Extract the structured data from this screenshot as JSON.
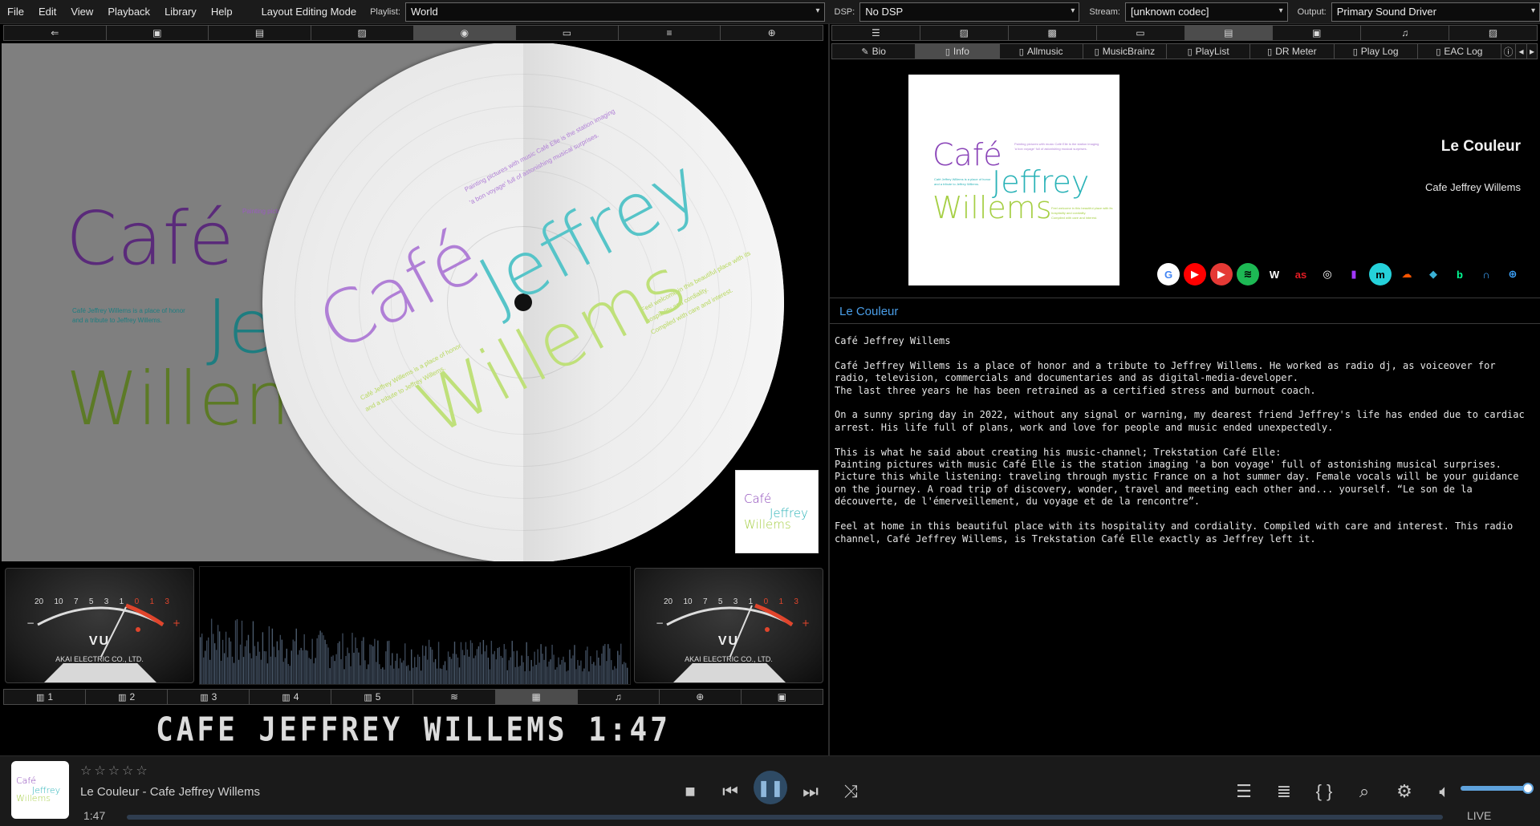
{
  "menubar": {
    "items": [
      "File",
      "Edit",
      "View",
      "Playback",
      "Library",
      "Help"
    ],
    "layout_mode": "Layout Editing Mode",
    "playlist_label": "Playlist:",
    "playlist_value": "World",
    "dsp_label": "DSP:",
    "dsp_value": "No DSP",
    "stream_label": "Stream:",
    "stream_value": "[unknown codec]",
    "output_label": "Output:",
    "output_value": "Primary Sound Driver"
  },
  "left_toolbar_icons": [
    "back-icon",
    "box-icon",
    "archive-icon",
    "image-icon",
    "disc-icon",
    "caption-icon",
    "stack-icon",
    "target-icon"
  ],
  "right_toolbar_icons": [
    "list-icon",
    "image-icon",
    "photo-icon",
    "caption-icon",
    "document-icon",
    "archive-icon",
    "music-icon",
    "image2-icon"
  ],
  "right_tabs": [
    {
      "label": "Bio",
      "icon": "pencil-icon",
      "active": false
    },
    {
      "label": "Info",
      "icon": "clipboard-icon",
      "active": true
    },
    {
      "label": "Allmusic",
      "icon": "clipboard-icon",
      "active": false
    },
    {
      "label": "MusicBrainz",
      "icon": "clipboard-icon",
      "active": false
    },
    {
      "label": "PlayList",
      "icon": "clipboard-icon",
      "active": false
    },
    {
      "label": "DR Meter",
      "icon": "clipboard-icon",
      "active": false
    },
    {
      "label": "Play Log",
      "icon": "clipboard-icon",
      "active": false
    },
    {
      "label": "EAC Log",
      "icon": "clipboard-icon",
      "active": false
    }
  ],
  "artwork": {
    "word1": "Café",
    "word2": "Jeffrey",
    "word3": "Willems",
    "tagline1": "Painting pictures with music Café Elle is the station imaging",
    "tagline2": "'a bon voyage' full of astonishing musical surprises.",
    "caption1": "Café Jeffrey Willems is a place of honor",
    "caption2": "and a tribute to Jeffrey Willems.",
    "caption3": "Feel welcome in this beautiful place with its",
    "caption4": "hospitality and cordiality.",
    "caption5": "Compiled with care and interest."
  },
  "vu": {
    "scale": [
      "20",
      "10",
      "7",
      "5",
      "3",
      "1",
      "0",
      "1",
      "3"
    ],
    "label": "VU",
    "brand": "AKAI ELECTRIC CO., LTD."
  },
  "visual_tabs": [
    {
      "label": "1",
      "icon": "bar-chart-icon",
      "active": false
    },
    {
      "label": "2",
      "icon": "bar-chart-icon",
      "active": false
    },
    {
      "label": "3",
      "icon": "bar-chart-icon",
      "active": false
    },
    {
      "label": "4",
      "icon": "bar-chart-icon",
      "active": false
    },
    {
      "label": "5",
      "icon": "bar-chart-icon",
      "active": false
    },
    {
      "label": "",
      "icon": "waves-icon",
      "active": false
    },
    {
      "label": "",
      "icon": "display-icon",
      "active": true
    },
    {
      "label": "",
      "icon": "music-icon",
      "active": false
    },
    {
      "label": "",
      "icon": "globe-icon",
      "active": false
    },
    {
      "label": "",
      "icon": "calendar-icon",
      "active": false
    }
  ],
  "display_text": "CAFE JEFFREY WILLEMS 1:47",
  "track": {
    "title": "Le Couleur",
    "artist": "Cafe Jeffrey Willems"
  },
  "link_icons": [
    {
      "name": "google-icon",
      "glyph": "G",
      "color": "#ffffff",
      "fg": "#4285f4"
    },
    {
      "name": "youtube-icon",
      "glyph": "▶",
      "color": "#ff0000",
      "fg": "#ffffff"
    },
    {
      "name": "youtube-music-icon",
      "glyph": "▶",
      "color": "#e53935",
      "fg": "#ffffff"
    },
    {
      "name": "spotify-icon",
      "glyph": "≋",
      "color": "#1db954",
      "fg": "#000000"
    },
    {
      "name": "wikipedia-icon",
      "glyph": "W",
      "color": "#000000",
      "fg": "#ffffff"
    },
    {
      "name": "lastfm-icon",
      "glyph": "as",
      "color": "#000000",
      "fg": "#e31b23"
    },
    {
      "name": "discogs-icon",
      "glyph": "◎",
      "color": "#000000",
      "fg": "#ffffff"
    },
    {
      "name": "deezer-icon",
      "glyph": "▮",
      "color": "#000000",
      "fg": "#a238ff"
    },
    {
      "name": "amazon-music-icon",
      "glyph": "m",
      "color": "#25d1da",
      "fg": "#000000"
    },
    {
      "name": "soundcloud-icon",
      "glyph": "☁",
      "color": "#000000",
      "fg": "#ff5500"
    },
    {
      "name": "tidal-icon",
      "glyph": "◆",
      "color": "#000000",
      "fg": "#39b0d4"
    },
    {
      "name": "beatport-icon",
      "glyph": "b",
      "color": "#000000",
      "fg": "#01ff95"
    },
    {
      "name": "headphones-icon",
      "glyph": "∩",
      "color": "#000000",
      "fg": "#3ea6ff"
    },
    {
      "name": "www-icon",
      "glyph": "⊕",
      "color": "#000000",
      "fg": "#3ea6ff"
    }
  ],
  "info_header": "Le Couleur",
  "bio": {
    "p0": "Café Jeffrey Willems",
    "p1": "Café Jeffrey Willems is a place of honor and a tribute to Jeffrey Willems. He worked as radio dj, as voiceover for radio, television, commercials and documentaries and as digital-media-developer.\nThe last three years he has been retrained as a certified stress and burnout coach.",
    "p2": "On a sunny spring day in 2022, without any signal or warning, my dearest friend Jeffrey's life has ended due to cardiac arrest. His life full of plans, work and love for people and music ended unexpectedly.",
    "p3": "This is what he said about creating his music-channel; Trekstation Café Elle:\nPainting pictures with music Café Elle is the station imaging 'a bon voyage' full of astonishing musical surprises.\nPicture this while listening: traveling through mystic France on a hot summer day. Female vocals will be your guidance on the journey. A road trip of discovery, wonder, travel and meeting each other and... yourself. “Le son de la découverte, de l'émerveillement, du voyage et de la rencontre”.",
    "p4": "Feel at home in this beautiful place with its hospitality and cordiality. Compiled with care and interest. This radio channel, Café Jeffrey Willems, is Trekstation Café Elle exactly as Jeffrey left it."
  },
  "player": {
    "stars": "☆☆☆☆☆",
    "now_playing": "Le Couleur - Cafe Jeffrey Willems",
    "elapsed": "1:47",
    "live": "LIVE",
    "volume": 1.0
  },
  "colors": {
    "cafe": "#8a44b8",
    "jeffrey": "#2bb3b8",
    "willems": "#a6cf45",
    "accent": "#4a9ee8"
  }
}
